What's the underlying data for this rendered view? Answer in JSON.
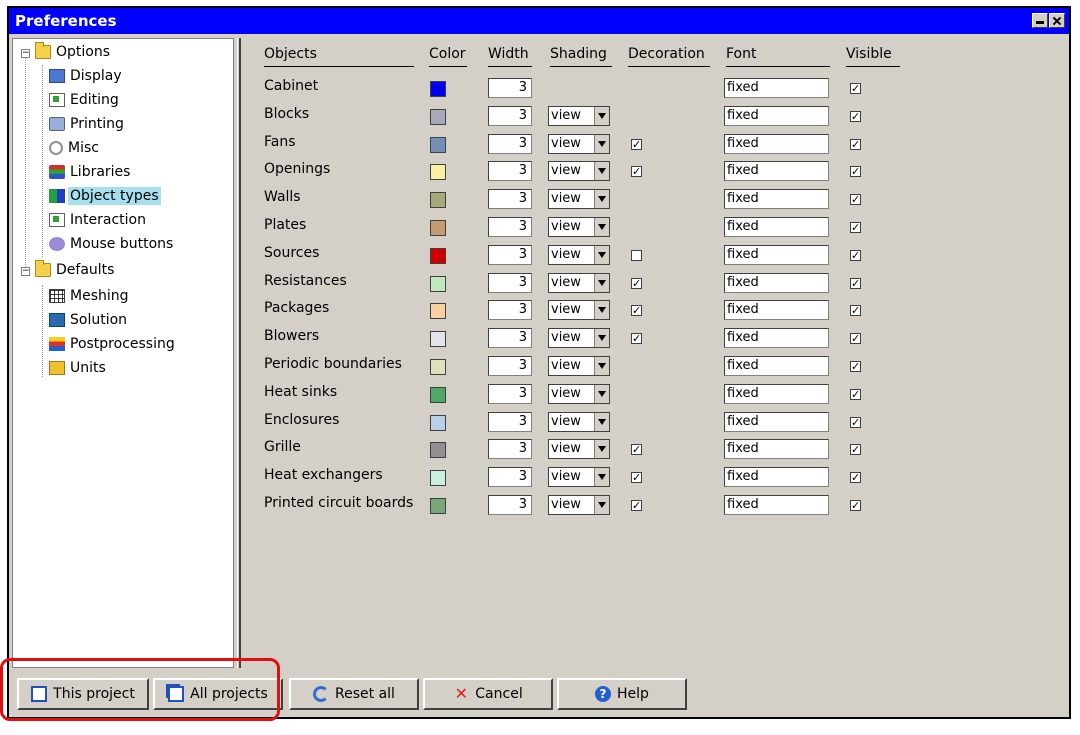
{
  "window": {
    "title": "Preferences"
  },
  "tree": {
    "options": "Options",
    "display": "Display",
    "editing": "Editing",
    "printing": "Printing",
    "misc": "Misc",
    "libraries": "Libraries",
    "object_types": "Object types",
    "interaction": "Interaction",
    "mouse_buttons": "Mouse buttons",
    "defaults": "Defaults",
    "meshing": "Meshing",
    "solution": "Solution",
    "postprocessing": "Postprocessing",
    "units": "Units"
  },
  "headers": {
    "objects": "Objects",
    "color": "Color",
    "width": "Width",
    "shading": "Shading",
    "decoration": "Decoration",
    "font": "Font",
    "visible": "Visible"
  },
  "rows": [
    {
      "name": "Cabinet",
      "color": "#0000ee",
      "width": "3",
      "shading": null,
      "decoration": null,
      "font": "fixed",
      "visible": true
    },
    {
      "name": "Blocks",
      "color": "#a8a8b8",
      "width": "3",
      "shading": "view",
      "decoration": null,
      "font": "fixed",
      "visible": true
    },
    {
      "name": "Fans",
      "color": "#7090b8",
      "width": "3",
      "shading": "view",
      "decoration": true,
      "font": "fixed",
      "visible": true
    },
    {
      "name": "Openings",
      "color": "#f8f0a0",
      "width": "3",
      "shading": "view",
      "decoration": true,
      "font": "fixed",
      "visible": true
    },
    {
      "name": "Walls",
      "color": "#a8a878",
      "width": "3",
      "shading": "view",
      "decoration": null,
      "font": "fixed",
      "visible": true
    },
    {
      "name": "Plates",
      "color": "#c89870",
      "width": "3",
      "shading": "view",
      "decoration": null,
      "font": "fixed",
      "visible": true
    },
    {
      "name": "Sources",
      "color": "#cc0000",
      "width": "3",
      "shading": "view",
      "decoration": false,
      "font": "fixed",
      "visible": true
    },
    {
      "name": "Resistances",
      "color": "#c0e8c0",
      "width": "3",
      "shading": "view",
      "decoration": true,
      "font": "fixed",
      "visible": true
    },
    {
      "name": "Packages",
      "color": "#f8d0a0",
      "width": "3",
      "shading": "view",
      "decoration": true,
      "font": "fixed",
      "visible": true
    },
    {
      "name": "Blowers",
      "color": "#e4e4ec",
      "width": "3",
      "shading": "view",
      "decoration": true,
      "font": "fixed",
      "visible": true
    },
    {
      "name": "Periodic boundaries",
      "color": "#e0e0b8",
      "width": "3",
      "shading": "view",
      "decoration": null,
      "font": "fixed",
      "visible": true
    },
    {
      "name": "Heat sinks",
      "color": "#50a868",
      "width": "3",
      "shading": "view",
      "decoration": null,
      "font": "fixed",
      "visible": true
    },
    {
      "name": "Enclosures",
      "color": "#b8d0e8",
      "width": "3",
      "shading": "view",
      "decoration": null,
      "font": "fixed",
      "visible": true
    },
    {
      "name": "Grille",
      "color": "#909090",
      "width": "3",
      "shading": "view",
      "decoration": true,
      "font": "fixed",
      "visible": true
    },
    {
      "name": "Heat exchangers",
      "color": "#c8f0e0",
      "width": "3",
      "shading": "view",
      "decoration": true,
      "font": "fixed",
      "visible": true
    },
    {
      "name": "Printed circuit boards",
      "color": "#78a878",
      "width": "3",
      "shading": "view",
      "decoration": true,
      "font": "fixed",
      "visible": true
    }
  ],
  "buttons": {
    "this_project": "This project",
    "all_projects": "All projects",
    "reset_all": "Reset all",
    "cancel": "Cancel",
    "help": "Help"
  }
}
